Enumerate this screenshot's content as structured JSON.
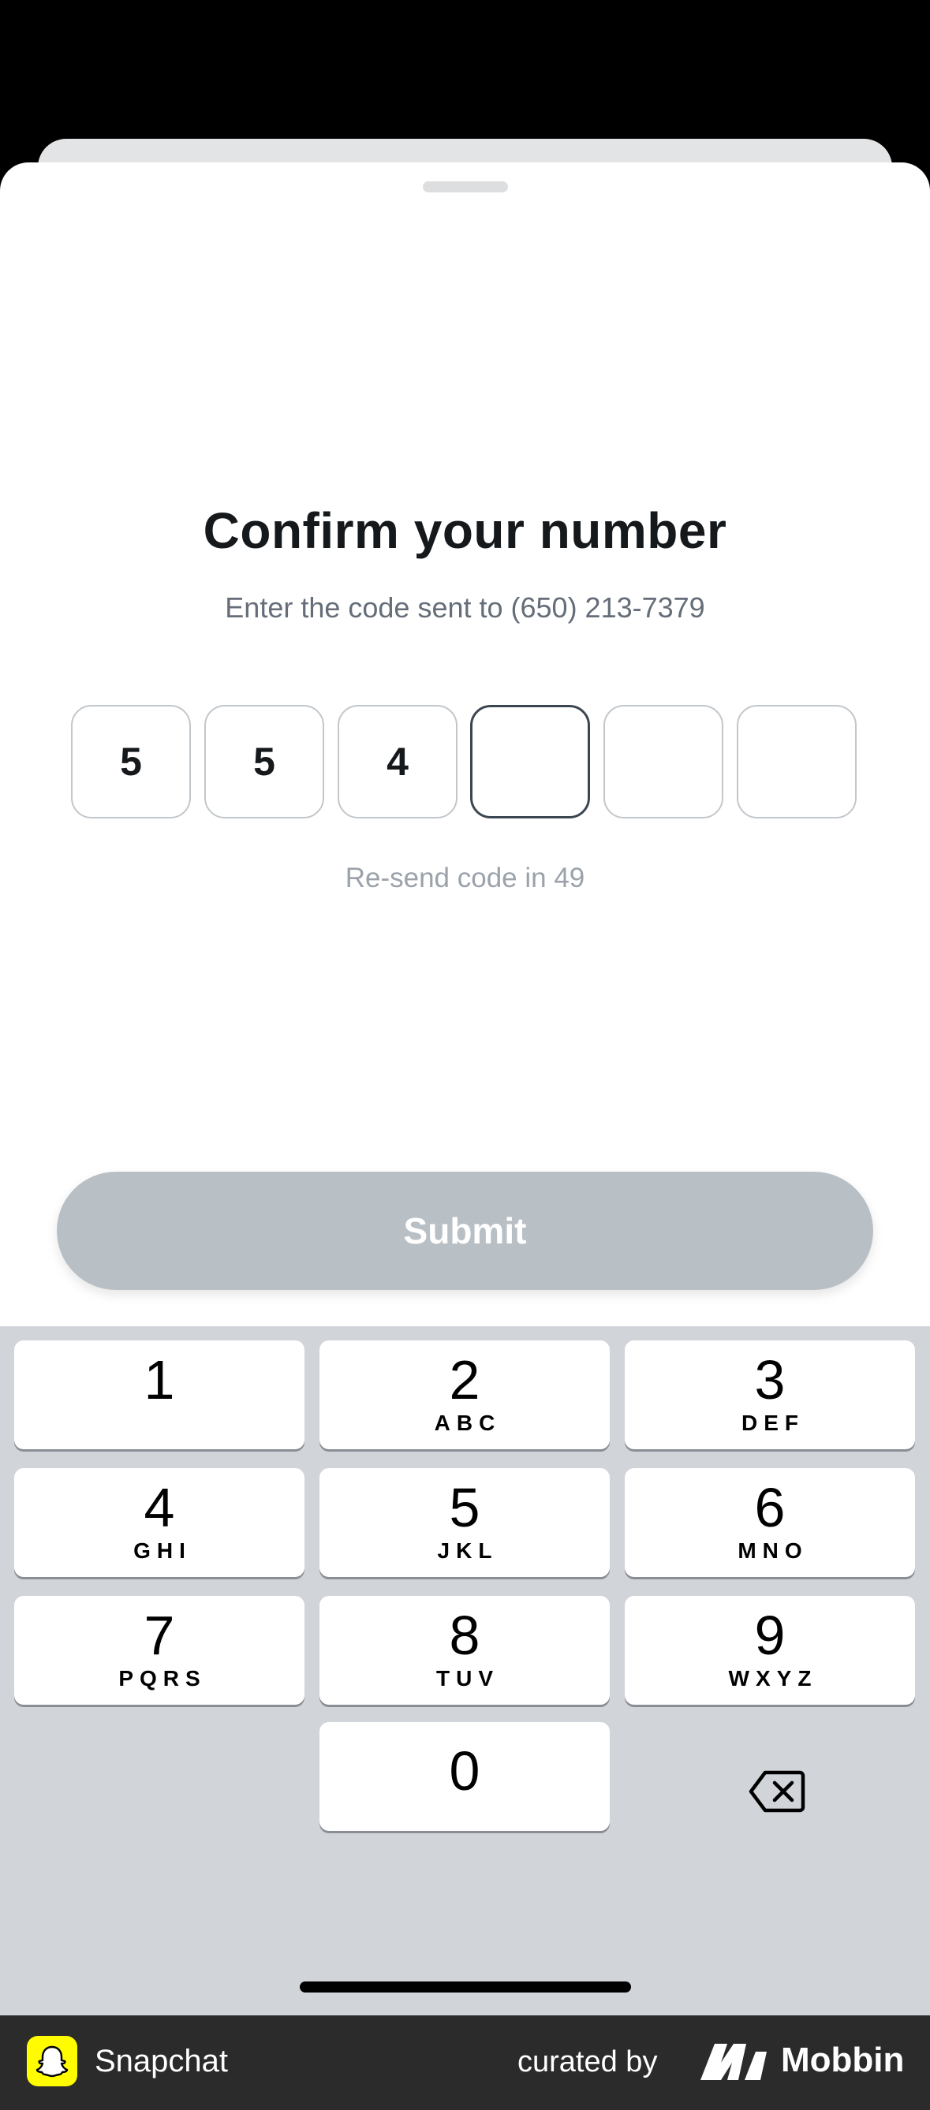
{
  "sheet": {
    "title": "Confirm your number",
    "subtitle": "Enter the code sent to (650) 213-7379",
    "otp": [
      "5",
      "5",
      "4",
      "",
      "",
      ""
    ],
    "otp_active_index": 3,
    "resend": "Re-send code in 49",
    "submit_label": "Submit"
  },
  "keyboard": {
    "keys": [
      {
        "digit": "1",
        "letters": ""
      },
      {
        "digit": "2",
        "letters": "ABC"
      },
      {
        "digit": "3",
        "letters": "DEF"
      },
      {
        "digit": "4",
        "letters": "GHI"
      },
      {
        "digit": "5",
        "letters": "JKL"
      },
      {
        "digit": "6",
        "letters": "MNO"
      },
      {
        "digit": "7",
        "letters": "PQRS"
      },
      {
        "digit": "8",
        "letters": "TUV"
      },
      {
        "digit": "9",
        "letters": "WXYZ"
      },
      {
        "digit": "0",
        "letters": ""
      }
    ],
    "delete_icon": "backspace-icon"
  },
  "footer": {
    "app_name": "Snapchat",
    "curated_by": "curated by",
    "brand": "Mobbin"
  },
  "colors": {
    "submit_disabled": "#b9c0c5",
    "keyboard_bg": "#d1d4d9",
    "snapchat_yellow": "#fffc00",
    "footer_bg": "#2b2b2b"
  }
}
